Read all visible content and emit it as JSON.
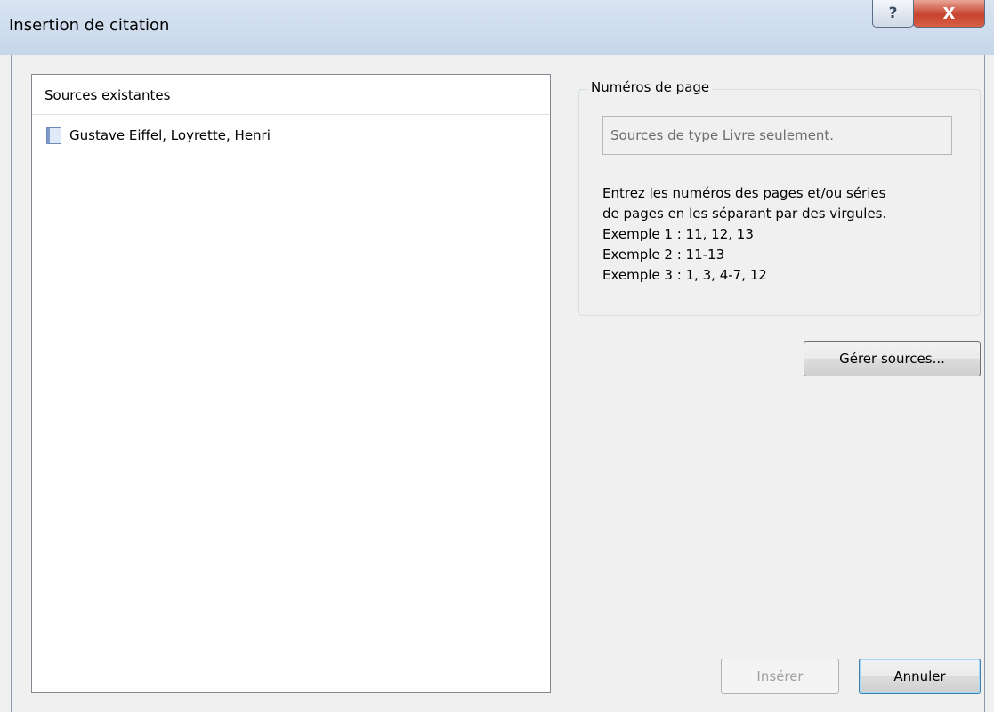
{
  "window": {
    "title": "Insertion de citation",
    "help_glyph": "?",
    "close_glyph": "X"
  },
  "sources": {
    "header": "Sources existantes",
    "items": [
      {
        "label": "Gustave Eiffel, Loyrette, Henri",
        "icon": "book-icon"
      }
    ]
  },
  "page_numbers": {
    "legend": "Numéros de page",
    "placeholder": "Sources de type Livre seulement.",
    "help_lines": [
      "Entrez les numéros des pages et/ou séries",
      "de pages en les séparant par des virgules.",
      "Exemple 1 : 11, 12, 13",
      "Exemple 2 : 11-13",
      "Exemple 3 : 1, 3, 4-7, 12"
    ]
  },
  "buttons": {
    "manage": "Gérer sources...",
    "insert": "Insérer",
    "cancel": "Annuler"
  }
}
